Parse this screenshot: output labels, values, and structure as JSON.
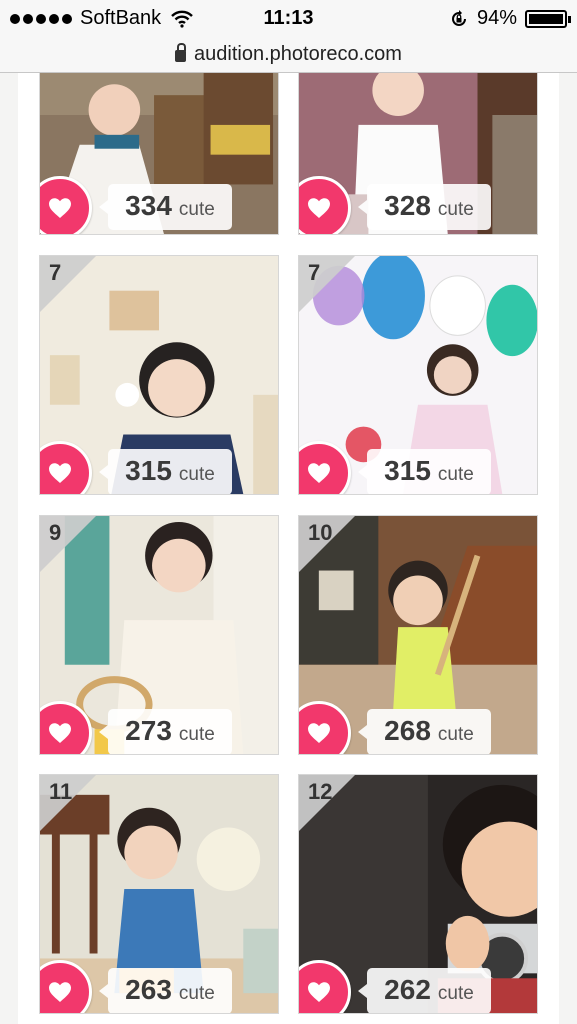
{
  "status_bar": {
    "carrier": "SoftBank",
    "time": "11:13",
    "battery": "94%",
    "signal_icon": "signal-dots-icon",
    "wifi_icon": "wifi-icon",
    "rotation_lock_icon": "rotation-lock-icon",
    "battery_icon": "battery-icon"
  },
  "browser": {
    "url": "audition.photoreco.com",
    "lock_icon": "lock-icon"
  },
  "colors": {
    "heart_button": "#f2386c",
    "rank_corner": "#cdcdcd",
    "count_text": "#3a3a3a"
  },
  "entries": [
    {
      "rank": "",
      "count": "334",
      "unit": "cute",
      "heart_icon": "heart-icon"
    },
    {
      "rank": "",
      "count": "328",
      "unit": "cute",
      "heart_icon": "heart-icon"
    },
    {
      "rank": "7",
      "count": "315",
      "unit": "cute",
      "heart_icon": "heart-icon"
    },
    {
      "rank": "7",
      "count": "315",
      "unit": "cute",
      "heart_icon": "heart-icon"
    },
    {
      "rank": "9",
      "count": "273",
      "unit": "cute",
      "heart_icon": "heart-icon"
    },
    {
      "rank": "10",
      "count": "268",
      "unit": "cute",
      "heart_icon": "heart-icon"
    },
    {
      "rank": "11",
      "count": "263",
      "unit": "cute",
      "heart_icon": "heart-icon"
    },
    {
      "rank": "12",
      "count": "262",
      "unit": "cute",
      "heart_icon": "heart-icon"
    }
  ]
}
